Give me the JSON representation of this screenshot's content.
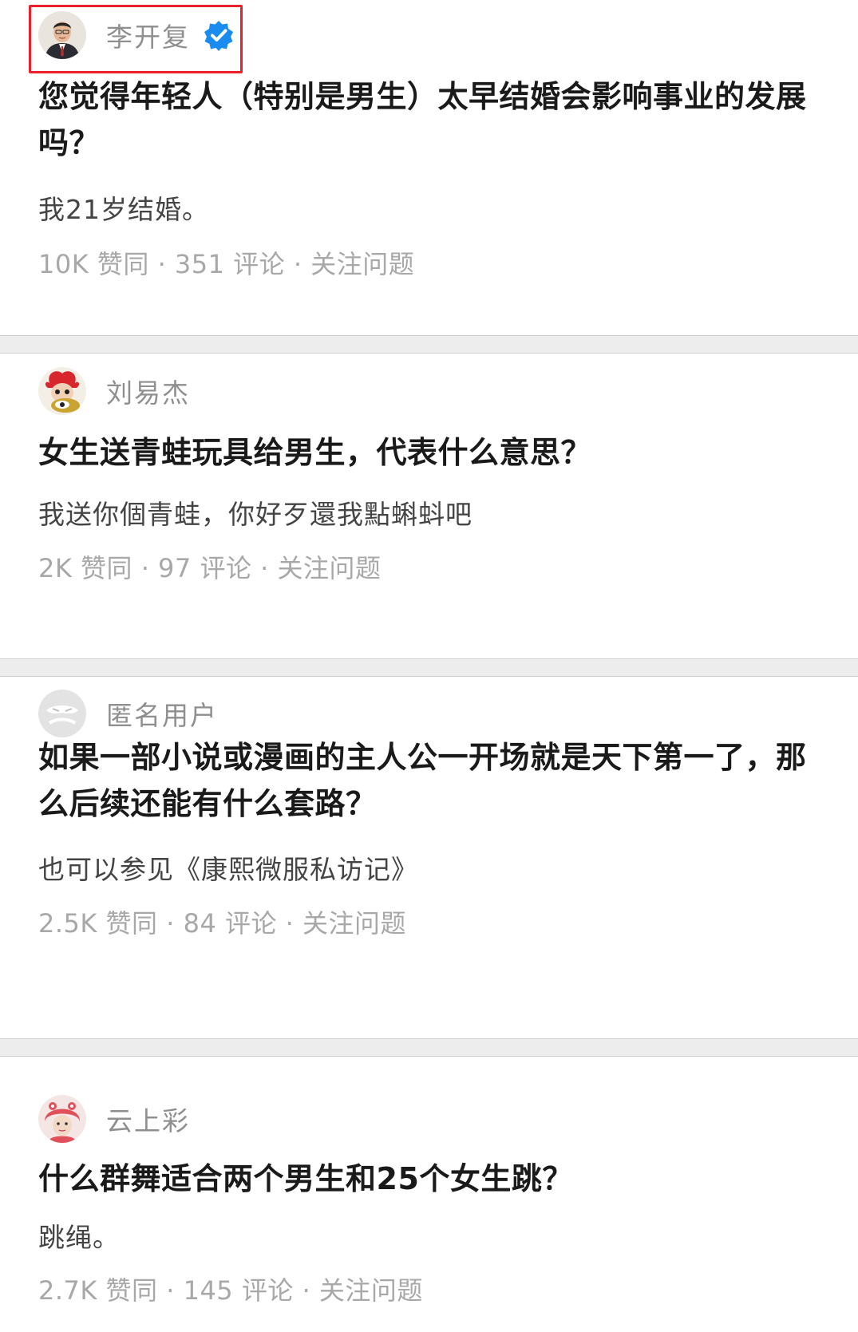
{
  "feed": [
    {
      "author": "李开复",
      "verified": true,
      "question": "您觉得年轻人（特别是男生）太早结婚会影响事业的发展吗？",
      "answer": "我21岁结婚。",
      "likes": "10K 赞同",
      "comments": "351 评论",
      "follow": "关注问题"
    },
    {
      "author": "刘易杰",
      "verified": false,
      "question": "女生送青蛙玩具给男生，代表什么意思？",
      "answer": "我送你個青蛙，你好歹還我點蝌蚪吧",
      "likes": "2K 赞同",
      "comments": "97 评论",
      "follow": "关注问题"
    },
    {
      "author": "匿名用户",
      "verified": false,
      "question": "如果一部小说或漫画的主人公一开场就是天下第一了，那么后续还能有什么套路？",
      "answer": "也可以参见《康熙微服私访记》",
      "likes": "2.5K 赞同",
      "comments": "84 评论",
      "follow": "关注问题"
    },
    {
      "author": "云上彩",
      "verified": false,
      "question": "什么群舞适合两个男生和25个女生跳？",
      "answer": "跳绳。",
      "likes": "2.7K 赞同",
      "comments": "145 评论",
      "follow": "关注问题"
    }
  ],
  "meta_separator": " · ",
  "colors": {
    "highlight": "#e8212b",
    "verified_badge": "#1a8cf0",
    "meta_text": "#a8a8a8"
  },
  "icons": [
    "verified-badge-icon"
  ]
}
